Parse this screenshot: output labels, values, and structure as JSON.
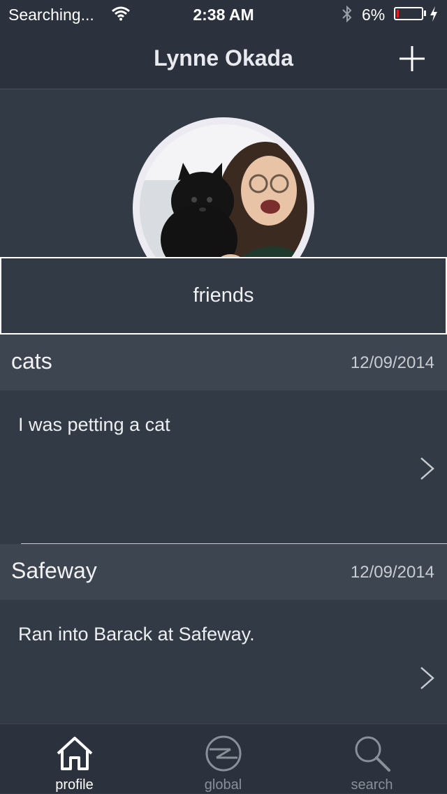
{
  "status_bar": {
    "carrier": "Searching...",
    "time": "2:38 AM",
    "battery_percent": "6%",
    "battery_level": 0.06,
    "icons": [
      "wifi-icon",
      "bluetooth-icon",
      "battery-icon",
      "charging-bolt-icon"
    ]
  },
  "nav": {
    "title": "Lynne Okada",
    "add_icon": "plus-icon"
  },
  "profile": {
    "avatar_icon": "avatar-photo"
  },
  "friends_button": {
    "label": "friends"
  },
  "posts": [
    {
      "title": "cats",
      "date": "12/09/2014",
      "text": "I was petting a cat"
    },
    {
      "title": "Safeway",
      "date": "12/09/2014",
      "text": "Ran into Barack at Safeway."
    }
  ],
  "tabs": [
    {
      "label": "profile",
      "icon": "home-icon",
      "active": true
    },
    {
      "label": "global",
      "icon": "globe-icon",
      "active": false
    },
    {
      "label": "search",
      "icon": "search-icon",
      "active": false
    }
  ],
  "colors": {
    "background": "#323a46",
    "bar": "#2b323d",
    "post_header": "#3c4550",
    "battery_low": "#e02020"
  }
}
